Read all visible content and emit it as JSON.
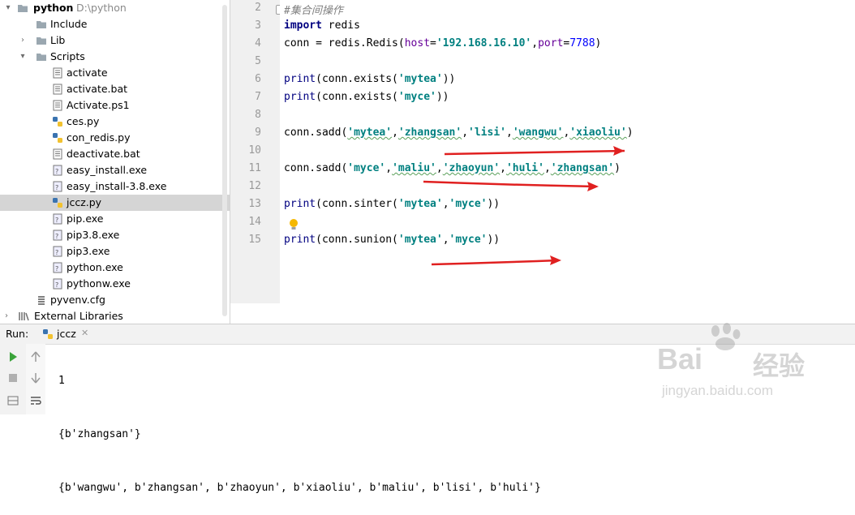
{
  "project": {
    "root_name": "python",
    "root_path": "D:\\python",
    "items": [
      {
        "label": "Include",
        "type": "folder"
      },
      {
        "label": "Lib",
        "type": "folder"
      },
      {
        "label": "Scripts",
        "type": "folder"
      },
      {
        "label": "activate",
        "type": "file"
      },
      {
        "label": "activate.bat",
        "type": "file"
      },
      {
        "label": "Activate.ps1",
        "type": "file"
      },
      {
        "label": "ces.py",
        "type": "python"
      },
      {
        "label": "con_redis.py",
        "type": "python"
      },
      {
        "label": "deactivate.bat",
        "type": "file"
      },
      {
        "label": "easy_install.exe",
        "type": "exe"
      },
      {
        "label": "easy_install-3.8.exe",
        "type": "exe"
      },
      {
        "label": "jccz.py",
        "type": "python"
      },
      {
        "label": "pip.exe",
        "type": "exe"
      },
      {
        "label": "pip3.8.exe",
        "type": "exe"
      },
      {
        "label": "pip3.exe",
        "type": "exe"
      },
      {
        "label": "python.exe",
        "type": "exe"
      },
      {
        "label": "pythonw.exe",
        "type": "exe"
      },
      {
        "label": "pyvenv.cfg",
        "type": "cfg"
      },
      {
        "label": "External Libraries",
        "type": "library"
      }
    ]
  },
  "editor": {
    "line_numbers": [
      "2",
      "3",
      "4",
      "5",
      "6",
      "7",
      "8",
      "9",
      "10",
      "11",
      "12",
      "13",
      "14",
      "15"
    ],
    "code": {
      "l2_comment": "#集合间操作",
      "l3_kw": "import",
      "l3_rest": " redis",
      "l4_a": "conn = redis.Redis(",
      "l4_host": "host",
      "l4_eq": "=",
      "l4_hostval": "'192.168.16.10'",
      "l4_comma": ",",
      "l4_port": "port",
      "l4_eq2": "=",
      "l4_portval": "7788",
      "l4_close": ")",
      "l6_print": "print",
      "l6_a": "(conn.exists(",
      "l6_s": "'mytea'",
      "l6_b": "))",
      "l7_print": "print",
      "l7_a": "(conn.exists(",
      "l7_s": "'myce'",
      "l7_b": "))",
      "l9_a": "conn.sadd(",
      "l9_s1": "'mytea'",
      "l9_s2": "'zhangsan'",
      "l9_s3": "'lisi'",
      "l9_s4": "'wangwu'",
      "l9_s5": "'xiaoliu'",
      "l11_a": "conn.sadd(",
      "l11_s1": "'myce'",
      "l11_s2": "'maliu'",
      "l11_s3": "'zhaoyun'",
      "l11_s4": "'huli'",
      "l11_s5": "'zhangsan'",
      "l13_print": "print",
      "l13_a": "(conn.sinter(",
      "l13_s1": "'mytea'",
      "l13_s2": "'myce'",
      "l13_b": "))",
      "l15_print": "print",
      "l15_a": "(conn.sunion(",
      "l15_s1": "'mytea'",
      "l15_s2": "'myce'",
      "l15_b": "))",
      "comma": ",",
      "close_paren": ")"
    }
  },
  "run": {
    "label": "Run:",
    "tab_name": "jccz",
    "output": [
      "1",
      "{b'zhangsan'}",
      "{b'wangwu', b'zhangsan', b'zhaoyun', b'xiaoliu', b'maliu', b'lisi', b'huli'}"
    ]
  },
  "watermark": {
    "brand": "Bai",
    "brand_cn": "经验",
    "url": "jingyan.baidu.com"
  },
  "colors": {
    "keyword": "#000080",
    "string": "#008080",
    "number": "#0000ff",
    "param": "#660099",
    "annotation_arrow": "#e02020",
    "run_green": "#3aa33a"
  }
}
